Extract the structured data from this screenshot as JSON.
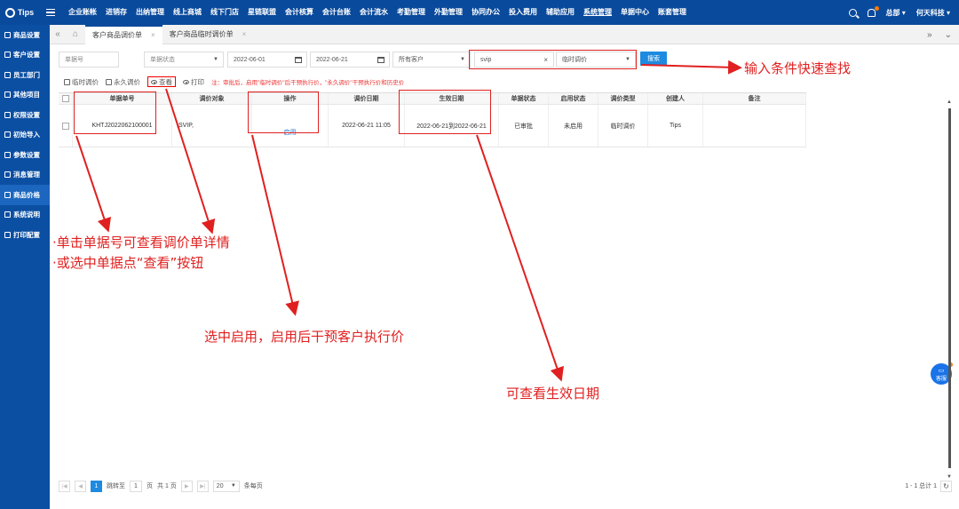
{
  "app": {
    "logo": "Tips"
  },
  "topnav": {
    "items": [
      "企业账帐",
      "进销存",
      "出纳管理",
      "线上商城",
      "线下门店",
      "星链联盟",
      "会计核算",
      "会计台账",
      "会计流水",
      "考勤管理",
      "外勤管理",
      "协同办公",
      "投入费用",
      "辅助应用",
      "系统管理",
      "单据中心",
      "账套管理"
    ],
    "active_index": 14,
    "user": "总部 ▾",
    "company": "何天科技 ▾"
  },
  "sidebar": {
    "items": [
      "商品设置",
      "客户设置",
      "员工部门",
      "其他项目",
      "权限设置",
      "初始导入",
      "参数设置",
      "消息管理",
      "商品价格",
      "系统说明",
      "打印配置"
    ],
    "active_index": 8
  },
  "tabs": {
    "items": [
      "客户商品调价单",
      "客户商品临时调价单"
    ],
    "active_index": 0
  },
  "filters": {
    "doc_no_placeholder": "单据号",
    "doc_status_placeholder": "单据状态",
    "date_from": "2022-06-01",
    "date_to": "2022-06-21",
    "customer_placeholder": "所有客户",
    "keyword": "svip",
    "price_type": "临时调价",
    "search_label": "搜索"
  },
  "toolbar": {
    "temp_price": "临时调价",
    "perm_price": "永久调价",
    "view": "查看",
    "print": "打印",
    "notice": "注：审批后，启用\"临时调价\"后干预执行价，\"永久调价\"干预执行价和历史价"
  },
  "table": {
    "columns": [
      "单据单号",
      "调价对象",
      "操作",
      "调价日期",
      "生效日期",
      "单据状态",
      "启用状态",
      "调价类型",
      "创建人",
      "备注"
    ],
    "rows": [
      {
        "doc_no": "KHTJ2022062100001",
        "target": ",SVIP,",
        "action": "启用",
        "adjust_date": "2022-06-21 11:05",
        "effective": "2022-06-21到2022-06-21",
        "doc_status": "已审批",
        "enable_status": "未启用",
        "price_type": "临时调价",
        "creator": "Tips",
        "remark": ""
      }
    ]
  },
  "pager": {
    "current_page": "1",
    "goto_label": "跳转至",
    "goto_value": "1",
    "page_label": "页",
    "total_pages": "共 1 页",
    "page_size": "20",
    "per_page_label": "条每页",
    "summary": "1 - 1 总计 1"
  },
  "widgets": {
    "kefu": "客服"
  },
  "annotations": {
    "quick_search": "输入条件快速查找",
    "detail_1": "·单击单据号可查看调价单详情",
    "detail_2": "·或选中单据点“查看”按钮",
    "enable_hint": "选中启用，启用后干预客户执行价",
    "effective_hint": "可查看生效日期"
  },
  "colors": {
    "topbar": "#0a4a9c",
    "sidebar": "#0b4fa3",
    "accent": "#1e8be0",
    "annotation": "#e02020"
  }
}
